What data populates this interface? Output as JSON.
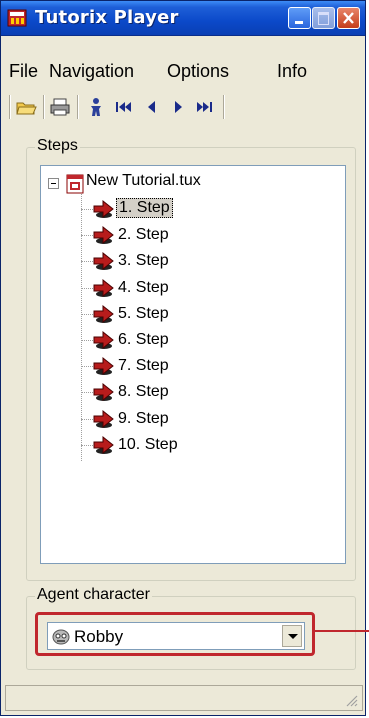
{
  "window": {
    "title": "Tutorix Player"
  },
  "menu": {
    "items": [
      "File",
      "Navigation",
      "Options",
      "Info"
    ]
  },
  "toolbar": {
    "tools": [
      "open-folder-icon",
      "print-icon",
      "agent-person-icon",
      "first-step-icon",
      "previous-step-icon",
      "next-step-icon",
      "last-step-icon"
    ]
  },
  "steps_group": {
    "label": "Steps",
    "root": "New Tutorial.tux",
    "items": [
      {
        "label": "1. Step",
        "selected": true
      },
      {
        "label": "2. Step"
      },
      {
        "label": "3. Step"
      },
      {
        "label": "4. Step"
      },
      {
        "label": "5. Step"
      },
      {
        "label": "6. Step"
      },
      {
        "label": "7. Step"
      },
      {
        "label": "8. Step"
      },
      {
        "label": "9. Step"
      },
      {
        "label": "10. Step"
      }
    ]
  },
  "agent_group": {
    "label": "Agent character",
    "selected": "Robby"
  },
  "colors": {
    "title_blue": "#0b49c9",
    "highlight_red": "#c0272d",
    "window_bg": "#ece9d8"
  }
}
